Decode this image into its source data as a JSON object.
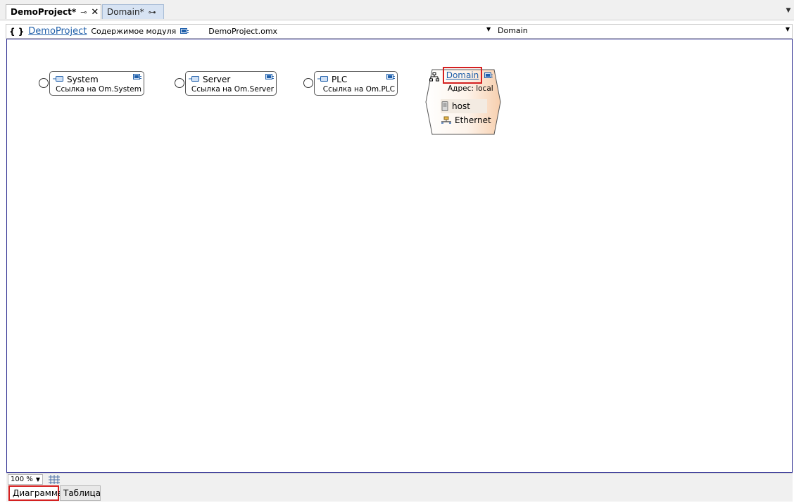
{
  "tabs": [
    {
      "label": "DemoProject*",
      "active": true
    },
    {
      "label": "Domain*",
      "active": false
    }
  ],
  "nav": {
    "braces": "{ }",
    "project": "DemoProject",
    "contents": "Содержимое модуля",
    "file": "DemoProject.omx",
    "selected": "Domain"
  },
  "nodes": [
    {
      "title": "System",
      "subtitle": "Ссылка на Om.System"
    },
    {
      "title": "Server",
      "subtitle": "Ссылка на Om.Server"
    },
    {
      "title": "PLC",
      "subtitle": "Ссылка на Om.PLC"
    }
  ],
  "domain": {
    "title": "Domain",
    "address": "Адрес: local",
    "items": [
      "host",
      "Ethernet"
    ]
  },
  "zoom": {
    "value": "100 %"
  },
  "view_tabs": [
    {
      "label": "Диаграмма",
      "active": true
    },
    {
      "label": "Таблица",
      "active": false
    }
  ],
  "colors": {
    "link": "#1f5faa",
    "highlight": "#d42020",
    "canvas_border": "#2a2a8f",
    "domain_fill": "#fbe3cf"
  }
}
